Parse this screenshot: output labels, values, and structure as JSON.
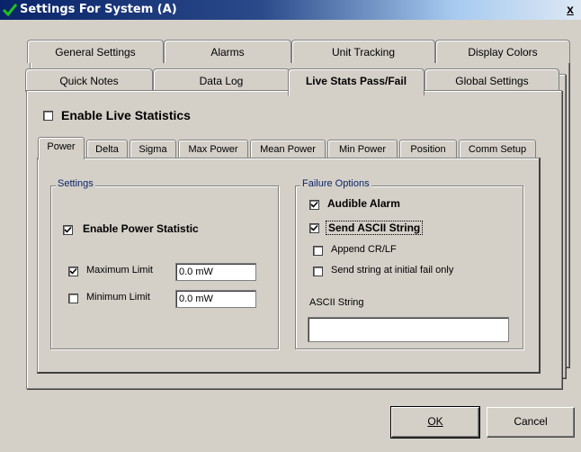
{
  "window": {
    "title": "Settings For System (A)",
    "close_label": "x"
  },
  "outer_tabs": {
    "row1": [
      "General Settings",
      "Alarms",
      "Unit Tracking",
      "Display Colors"
    ],
    "row2": [
      "Quick Notes",
      "Data Log",
      "Live Stats Pass/Fail",
      "Global Settings"
    ],
    "active": "Live Stats Pass/Fail"
  },
  "enable_live_statistics": {
    "label": "Enable Live Statistics",
    "checked": false
  },
  "inner_tabs": {
    "items": [
      "Power",
      "Delta",
      "Sigma",
      "Max Power",
      "Mean Power",
      "Min Power",
      "Position",
      "Comm Setup"
    ],
    "active": "Power"
  },
  "settings_group": {
    "title": "Settings",
    "enable_power_statistic": {
      "label": "Enable Power Statistic",
      "checked": true
    },
    "maximum_limit": {
      "label": "Maximum Limit",
      "checked": true,
      "value": "0.0 mW"
    },
    "minimum_limit": {
      "label": "Minimum Limit",
      "checked": false,
      "value": "0.0 mW"
    }
  },
  "failure_group": {
    "title": "Failure Options",
    "audible_alarm": {
      "label": "Audible Alarm",
      "checked": true
    },
    "send_ascii_string": {
      "label": "Send ASCII String",
      "checked": true
    },
    "append_crlf": {
      "label": "Append CR/LF",
      "checked": false
    },
    "send_initial_fail_only": {
      "label": "Send string at initial fail only",
      "checked": false
    },
    "ascii_string_label": "ASCII String",
    "ascii_string_value": ""
  },
  "buttons": {
    "ok": "OK",
    "cancel": "Cancel"
  },
  "colors": {
    "title_start": "#0a246a",
    "title_end": "#a6caf0",
    "face": "#d4d0c8"
  }
}
